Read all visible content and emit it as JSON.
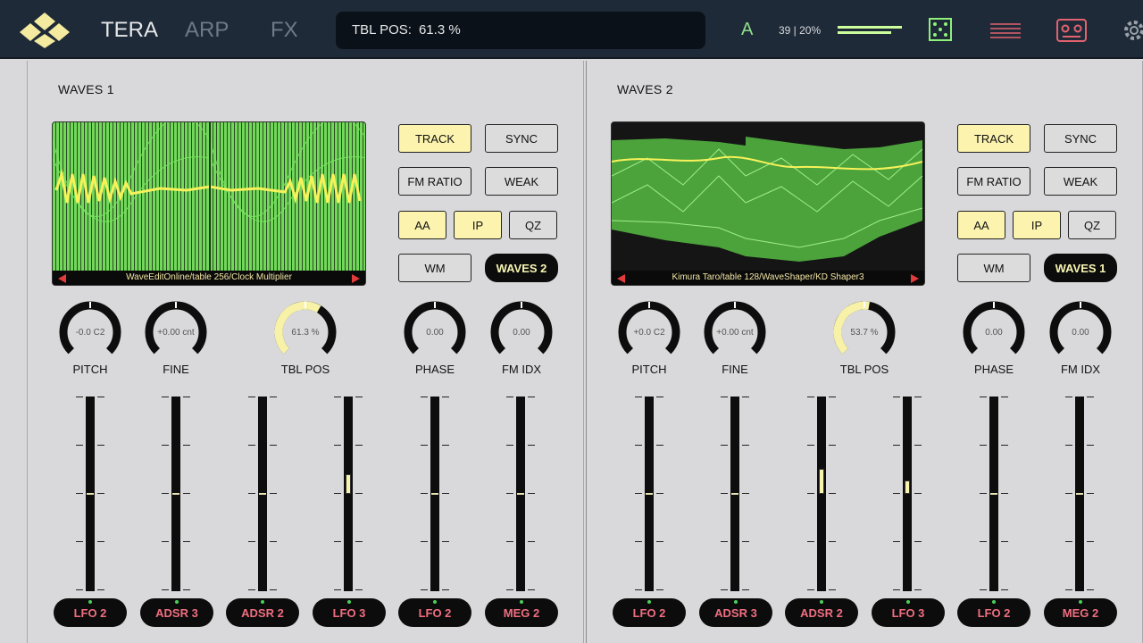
{
  "header": {
    "tabs": [
      {
        "label": "TERA"
      },
      {
        "label": "ARP"
      },
      {
        "label": "FX"
      }
    ],
    "tbl_label": "TBL POS:",
    "tbl_value": "61.3 %",
    "preset_letter": "A",
    "cpu_text": "39 | 20%",
    "icons": [
      "dice-icon",
      "lines-menu-icon",
      "tape-icon",
      "gear-icon"
    ],
    "accent_color": "#9de83a"
  },
  "waves": [
    {
      "title": "WAVES 1",
      "table_caption": "WaveEditOnline/table 256/Clock Multiplier",
      "buttons": {
        "track": "TRACK",
        "sync": "SYNC",
        "fm_ratio": "FM RATIO",
        "weak": "WEAK",
        "aa": "AA",
        "ip": "IP",
        "qz": "QZ",
        "wm": "WM",
        "source": "WAVES 2"
      },
      "knobs": [
        {
          "label": "PITCH",
          "value": "-0.0 C2",
          "level": 0.0
        },
        {
          "label": "FINE",
          "value": "+0.00 cnt",
          "level": 0.0
        },
        {
          "label": "TBL POS",
          "value": "61.3 %",
          "level": 0.613
        },
        {
          "label": "PHASE",
          "value": "0.00",
          "level": 0.0
        },
        {
          "label": "FM IDX",
          "value": "0.00",
          "level": 0.0
        }
      ],
      "faders": [
        0.5,
        0.5,
        0.5,
        0.6,
        0.5,
        0.5
      ],
      "mod_buttons": [
        "LFO 2",
        "ADSR 3",
        "ADSR 2",
        "LFO 3",
        "LFO 2",
        "MEG 2"
      ]
    },
    {
      "title": "WAVES 2",
      "table_caption": "Kimura Taro/table 128/WaveShaper/KD Shaper3",
      "buttons": {
        "track": "TRACK",
        "sync": "SYNC",
        "fm_ratio": "FM RATIO",
        "weak": "WEAK",
        "aa": "AA",
        "ip": "IP",
        "qz": "QZ",
        "wm": "WM",
        "source": "WAVES 1"
      },
      "knobs": [
        {
          "label": "PITCH",
          "value": "+0.0 C2",
          "level": 0.0
        },
        {
          "label": "FINE",
          "value": "+0.00 cnt",
          "level": 0.0
        },
        {
          "label": "TBL POS",
          "value": "53.7 %",
          "level": 0.537
        },
        {
          "label": "PHASE",
          "value": "0.00",
          "level": 0.0
        },
        {
          "label": "FM IDX",
          "value": "0.00",
          "level": 0.0
        }
      ],
      "faders": [
        0.5,
        0.5,
        0.63,
        0.57,
        0.5,
        0.5
      ],
      "mod_buttons": [
        "LFO 2",
        "ADSR 3",
        "ADSR 2",
        "LFO 3",
        "LFO 2",
        "MEG 2"
      ]
    }
  ]
}
